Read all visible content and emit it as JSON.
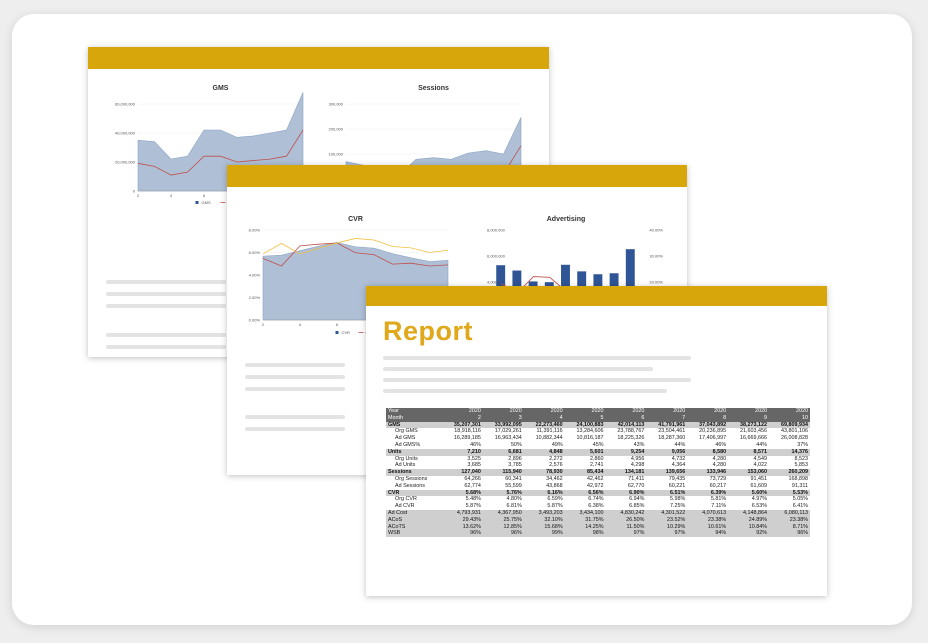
{
  "page1": {
    "chart_data": [
      {
        "type": "area",
        "title": "GMS",
        "x": [
          2,
          3,
          4,
          5,
          6,
          7,
          8,
          9,
          10,
          11,
          12
        ],
        "yticks": [
          "60,000,000",
          "40,000,000",
          "20,000,000",
          "0"
        ],
        "ylim": [
          0,
          60000000
        ],
        "series": [
          {
            "name": "GMS",
            "values": [
              35000000,
              34000000,
              22000000,
              24000000,
              42000000,
              42000000,
              37000000,
              38000000,
              40000000,
              42000000,
              68000000
            ]
          },
          {
            "name": "Org GMS",
            "values": [
              19000000,
              17000000,
              11000000,
              13000000,
              24000000,
              24000000,
              20000000,
              21000000,
              22000000,
              24000000,
              42000000
            ]
          }
        ],
        "legend": [
          "GMS",
          "Org GMS"
        ]
      },
      {
        "type": "area",
        "title": "Sessions",
        "x": [
          2,
          3,
          4,
          5,
          6,
          7,
          8,
          9,
          10,
          11,
          12
        ],
        "yticks": [
          "300,000",
          "200,000",
          "100,000"
        ],
        "ylim": [
          0,
          300000
        ],
        "series": [
          {
            "name": "Sessions",
            "values": [
              127000,
              116000,
              79000,
              85000,
              134000,
              139000,
              134000,
              153000,
              160000,
              150000,
              260000
            ]
          },
          {
            "name": "Org Sessions",
            "values": [
              64000,
              60000,
              35000,
              43000,
              71000,
              79000,
              74000,
              91000,
              95000,
              90000,
              175000
            ]
          }
        ]
      }
    ]
  },
  "page2": {
    "chart_data": [
      {
        "type": "line",
        "title": "CVR",
        "x": [
          2,
          3,
          4,
          5,
          6,
          7,
          8,
          9,
          10,
          11,
          12
        ],
        "yticks": [
          "8.00%",
          "6.00%",
          "4.00%",
          "2.00%",
          "0.00%"
        ],
        "ylim": [
          0,
          0.08
        ],
        "series": [
          {
            "name": "CVR",
            "values": [
              0.0568,
              0.0576,
              0.0616,
              0.0656,
              0.069,
              0.0651,
              0.0639,
              0.059,
              0.0553,
              0.052,
              0.053
            ]
          },
          {
            "name": "Org CVR",
            "values": [
              0.0548,
              0.048,
              0.0659,
              0.0674,
              0.0684,
              0.0598,
              0.0581,
              0.0497,
              0.0505,
              0.048,
              0.049
            ]
          },
          {
            "name": "Ad CVR",
            "values": [
              0.0587,
              0.0681,
              0.0587,
              0.0638,
              0.0685,
              0.0725,
              0.0711,
              0.0653,
              0.0641,
              0.06,
              0.062
            ]
          }
        ],
        "legend": [
          "CVR",
          "Org CVR"
        ]
      },
      {
        "type": "bar",
        "title": "Advertising",
        "categories": [
          2,
          3,
          4,
          5,
          6,
          7,
          8,
          9,
          10,
          11
        ],
        "yticks": [
          "8,000,000",
          "6,000,000",
          "4,000,000"
        ],
        "y2ticks": [
          "40.00%",
          "30.00%",
          "20.00%"
        ],
        "values": [
          4794000,
          4368000,
          3493000,
          3434000,
          4830000,
          4302000,
          4071000,
          4149000,
          6080000,
          3000000
        ],
        "line_values": [
          0.294,
          0.258,
          0.321,
          0.318,
          0.265,
          0.235,
          0.236,
          0.249,
          0.24,
          0.24
        ]
      }
    ]
  },
  "page3": {
    "title": "Report",
    "table": {
      "header": [
        [
          "Year",
          "2020",
          "2020",
          "2020",
          "2020",
          "2020",
          "2020",
          "2020",
          "2020",
          "2020"
        ],
        [
          "Month",
          "2",
          "3",
          "4",
          "5",
          "6",
          "7",
          "8",
          "9",
          "10"
        ]
      ],
      "rows": [
        {
          "kind": "sec",
          "cells": [
            "GMS",
            "35,207,301",
            "33,992,095",
            "22,273,460",
            "24,100,883",
            "42,014,113",
            "41,791,961",
            "37,043,892",
            "38,273,122",
            "69,809,934"
          ]
        },
        {
          "kind": "sub",
          "cells": [
            "Org GMS",
            "18,918,116",
            "17,029,261",
            "11,391,116",
            "13,284,606",
            "23,788,767",
            "23,504,461",
            "20,236,895",
            "21,603,456",
            "43,801,106"
          ]
        },
        {
          "kind": "sub",
          "cells": [
            "Ad GMS",
            "16,289,185",
            "16,963,434",
            "10,882,344",
            "10,816,187",
            "18,225,326",
            "18,287,360",
            "17,406,997",
            "16,669,666",
            "26,008,828"
          ]
        },
        {
          "kind": "sub",
          "cells": [
            "Ad GMS%",
            "46%",
            "50%",
            "49%",
            "45%",
            "43%",
            "44%",
            "46%",
            "44%",
            "37%"
          ]
        },
        {
          "kind": "sec",
          "cells": [
            "Units",
            "7,210",
            "6,681",
            "4,848",
            "5,601",
            "9,254",
            "9,056",
            "8,580",
            "8,571",
            "14,376"
          ]
        },
        {
          "kind": "sub",
          "cells": [
            "Org Units",
            "3,525",
            "2,896",
            "2,272",
            "2,860",
            "4,956",
            "4,732",
            "4,280",
            "4,549",
            "8,523"
          ]
        },
        {
          "kind": "sub",
          "cells": [
            "Ad Units",
            "3,685",
            "3,785",
            "2,576",
            "2,741",
            "4,298",
            "4,364",
            "4,280",
            "4,022",
            "5,853"
          ]
        },
        {
          "kind": "sec",
          "cells": [
            "Sessions",
            "127,040",
            "115,940",
            "78,930",
            "85,434",
            "134,181",
            "139,656",
            "133,946",
            "153,060",
            "260,209"
          ]
        },
        {
          "kind": "sub",
          "cells": [
            "Org Sessions",
            "64,266",
            "60,341",
            "34,462",
            "42,462",
            "71,411",
            "79,435",
            "73,729",
            "91,451",
            "168,898"
          ]
        },
        {
          "kind": "sub",
          "cells": [
            "Ad Sessions",
            "62,774",
            "55,599",
            "43,868",
            "42,972",
            "62,770",
            "60,221",
            "60,217",
            "61,609",
            "91,311"
          ]
        },
        {
          "kind": "sec",
          "cells": [
            "CVR",
            "5.68%",
            "5.76%",
            "6.16%",
            "6.56%",
            "6.90%",
            "6.51%",
            "6.39%",
            "5.60%",
            "5.53%"
          ]
        },
        {
          "kind": "sub",
          "cells": [
            "Org CVR",
            "5.48%",
            "4.80%",
            "6.59%",
            "6.74%",
            "6.94%",
            "5.98%",
            "5.81%",
            "4.97%",
            "5.05%"
          ]
        },
        {
          "kind": "sub",
          "cells": [
            "Ad CVR",
            "5.87%",
            "6.81%",
            "5.87%",
            "6.38%",
            "6.85%",
            "7.25%",
            "7.11%",
            "6.53%",
            "6.41%"
          ]
        },
        {
          "kind": "ad",
          "cells": [
            "Ad Cost",
            "4,793,931",
            "4,367,950",
            "3,493,203",
            "3,434,100",
            "4,830,242",
            "4,301,522",
            "4,070,613",
            "4,148,864",
            "6,080,113"
          ]
        },
        {
          "kind": "ad",
          "cells": [
            "ACoS",
            "29.43%",
            "25.75%",
            "32.10%",
            "31.75%",
            "26.50%",
            "23.52%",
            "23.38%",
            "24.89%",
            "23.38%"
          ]
        },
        {
          "kind": "ad",
          "cells": [
            "ACoTS",
            "13.62%",
            "12.85%",
            "15.68%",
            "14.25%",
            "11.50%",
            "10.29%",
            "10.61%",
            "10.84%",
            "8.71%"
          ]
        },
        {
          "kind": "ad",
          "cells": [
            "WSB",
            "96%",
            "96%",
            "99%",
            "98%",
            "97%",
            "97%",
            "94%",
            "92%",
            "96%"
          ]
        }
      ]
    }
  },
  "colors": {
    "accent": "#d6a60b",
    "title": "#e0a81a",
    "area": "#aebfd6",
    "bar": "#2f5597",
    "red": "#c0504d",
    "yellow": "#f0c040"
  }
}
